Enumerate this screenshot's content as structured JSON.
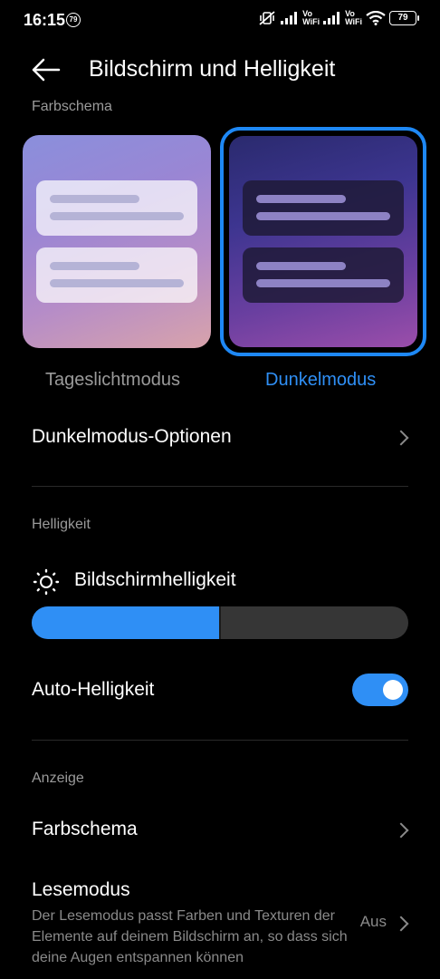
{
  "status": {
    "time": "16:15",
    "notification_badge": "79",
    "vowifi_1": [
      "Vo",
      "WiFi"
    ],
    "vowifi_2": [
      "Vo",
      "WiFi"
    ],
    "battery": "79"
  },
  "header": {
    "title": "Bildschirm und Helligkeit"
  },
  "color_scheme": {
    "section_label": "Farbschema",
    "light_label": "Tageslichtmodus",
    "dark_label": "Dunkelmodus",
    "selected": "dark",
    "accent_color": "#2f8ff5"
  },
  "dark_options": {
    "label": "Dunkelmodus-Optionen"
  },
  "brightness": {
    "section_label": "Helligkeit",
    "label": "Bildschirmhelligkeit",
    "level_percent": 50,
    "auto_label": "Auto-Helligkeit",
    "auto_enabled": true
  },
  "display": {
    "section_label": "Anzeige",
    "color_scheme_label": "Farbschema",
    "reading_mode_label": "Lesemodus",
    "reading_mode_desc": "Der Lesemodus passt Farben und Texturen der Elemente auf deinem Bildschirm an, so dass sich deine Augen entspannen können",
    "reading_mode_value": "Aus"
  }
}
